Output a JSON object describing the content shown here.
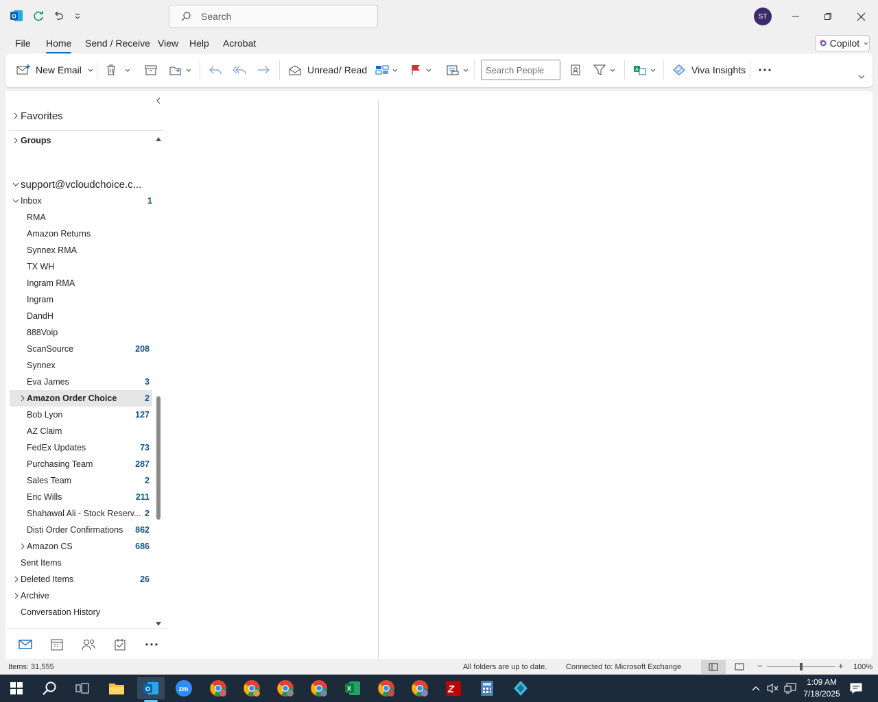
{
  "title_bar": {
    "search_placeholder": "Search",
    "avatar_initials": "ST"
  },
  "menu": {
    "tabs": [
      "File",
      "Home",
      "Send / Receive",
      "View",
      "Help",
      "Acrobat"
    ],
    "active": "Home",
    "copilot_label": "Copilot"
  },
  "ribbon": {
    "new_email": "New Email",
    "unread_read": "Unread/ Read",
    "search_people_placeholder": "Search People",
    "viva_insights": "Viva Insights"
  },
  "folders": {
    "favorites": "Favorites",
    "groups": "Groups",
    "account": "support@vcloudchoice.c...",
    "inbox": {
      "label": "Inbox",
      "count": "1"
    },
    "items": [
      {
        "label": "RMA",
        "count": ""
      },
      {
        "label": "Amazon Returns",
        "count": ""
      },
      {
        "label": "Synnex RMA",
        "count": ""
      },
      {
        "label": "TX WH",
        "count": ""
      },
      {
        "label": "Ingram RMA",
        "count": ""
      },
      {
        "label": "Ingram",
        "count": ""
      },
      {
        "label": "DandH",
        "count": ""
      },
      {
        "label": "888Voip",
        "count": ""
      },
      {
        "label": "ScanSource",
        "count": "208"
      },
      {
        "label": "Synnex",
        "count": ""
      },
      {
        "label": "Eva James",
        "count": "3"
      },
      {
        "label": "Amazon Order Choice",
        "count": "2"
      },
      {
        "label": "Bob Lyon",
        "count": "127"
      },
      {
        "label": "AZ Claim",
        "count": ""
      },
      {
        "label": "FedEx Updates",
        "count": "73"
      },
      {
        "label": "Purchasing Team",
        "count": "287"
      },
      {
        "label": "Sales Team",
        "count": "2"
      },
      {
        "label": "Eric Wills",
        "count": "211"
      },
      {
        "label": "Shahawal Ali - Stock Reserv...",
        "count": "2"
      },
      {
        "label": "Disti Order Confirmations",
        "count": "862"
      },
      {
        "label": "Amazon CS",
        "count": "686"
      }
    ],
    "top_level": [
      {
        "label": "Sent Items",
        "count": ""
      },
      {
        "label": "Deleted Items",
        "count": "26"
      },
      {
        "label": "Archive",
        "count": ""
      },
      {
        "label": "Conversation History",
        "count": ""
      }
    ]
  },
  "status_bar": {
    "items": "Items: 31,555",
    "sync": "All folders are up to date.",
    "connection": "Connected to: Microsoft Exchange",
    "zoom": "100%"
  },
  "taskbar": {
    "time": "1:09 AM",
    "date": "7/18/2025"
  },
  "colors": {
    "accent": "#0f6cbd",
    "count": "#0f548c",
    "taskbar": "#1c2a3a"
  }
}
